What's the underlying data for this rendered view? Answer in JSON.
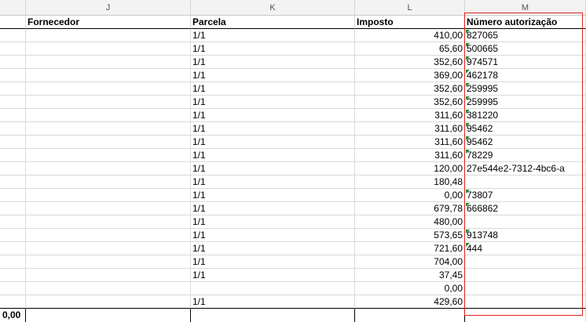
{
  "columns": [
    {
      "letter": "J"
    },
    {
      "letter": "K"
    },
    {
      "letter": "L"
    },
    {
      "letter": "M"
    }
  ],
  "headers": {
    "fornecedor": "Fornecedor",
    "parcela": "Parcela",
    "imposto": "Imposto",
    "autorizacao": "Número autorização"
  },
  "rows": [
    {
      "parcela": "1/1",
      "imposto": "410,00",
      "autorizacao": "827065",
      "flag": true
    },
    {
      "parcela": "1/1",
      "imposto": "65,60",
      "autorizacao": "500665",
      "flag": true
    },
    {
      "parcela": "1/1",
      "imposto": "352,60",
      "autorizacao": "974571",
      "flag": true
    },
    {
      "parcela": "1/1",
      "imposto": "369,00",
      "autorizacao": "462178",
      "flag": true
    },
    {
      "parcela": "1/1",
      "imposto": "352,60",
      "autorizacao": "259995",
      "flag": true
    },
    {
      "parcela": "1/1",
      "imposto": "352,60",
      "autorizacao": "259995",
      "flag": true
    },
    {
      "parcela": "1/1",
      "imposto": "311,60",
      "autorizacao": "381220",
      "flag": true
    },
    {
      "parcela": "1/1",
      "imposto": "311,60",
      "autorizacao": "95462",
      "flag": true
    },
    {
      "parcela": "1/1",
      "imposto": "311,60",
      "autorizacao": "95462",
      "flag": true
    },
    {
      "parcela": "1/1",
      "imposto": "311,60",
      "autorizacao": "78229",
      "flag": true
    },
    {
      "parcela": "1/1",
      "imposto": "120,00",
      "autorizacao": "27e544e2-7312-4bc6-a",
      "flag": false
    },
    {
      "parcela": "1/1",
      "imposto": "180,48",
      "autorizacao": "",
      "flag": false
    },
    {
      "parcela": "1/1",
      "imposto": "0,00",
      "autorizacao": "73807",
      "flag": true
    },
    {
      "parcela": "1/1",
      "imposto": "679,78",
      "autorizacao": "666862",
      "flag": true
    },
    {
      "parcela": "1/1",
      "imposto": "480,00",
      "autorizacao": "",
      "flag": false
    },
    {
      "parcela": "1/1",
      "imposto": "573,65",
      "autorizacao": "913748",
      "flag": true
    },
    {
      "parcela": "1/1",
      "imposto": "721,60",
      "autorizacao": "444",
      "flag": true
    },
    {
      "parcela": "1/1",
      "imposto": "704,00",
      "autorizacao": "",
      "flag": false
    },
    {
      "parcela": "1/1",
      "imposto": "37,45",
      "autorizacao": "",
      "flag": false
    },
    {
      "parcela": "",
      "imposto": "0,00",
      "autorizacao": "",
      "flag": false
    },
    {
      "parcela": "1/1",
      "imposto": "429,60",
      "autorizacao": "",
      "flag": false
    }
  ],
  "total_value": "0,00",
  "colors": {
    "highlight": "#e02020",
    "indicator": "#1a8f2e"
  }
}
